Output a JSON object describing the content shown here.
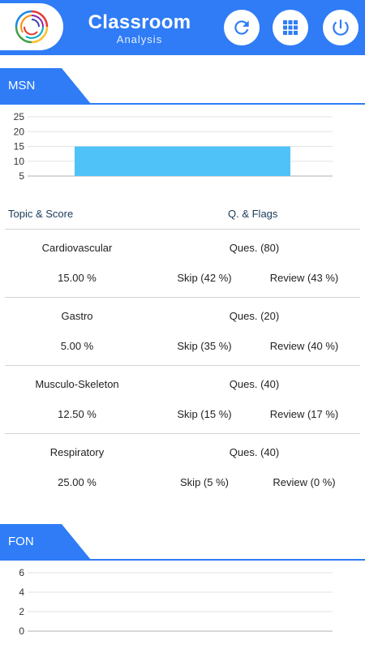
{
  "header": {
    "title": "Classroom",
    "subtitle": "Analysis",
    "logo_icon": "circular-rings-logo",
    "buttons": [
      {
        "name": "refresh-button",
        "icon": "refresh-icon"
      },
      {
        "name": "grid-menu-button",
        "icon": "grid-icon"
      },
      {
        "name": "power-button",
        "icon": "power-icon"
      }
    ],
    "accent_color": "#2f7cf6"
  },
  "sections": [
    {
      "label": "MSN",
      "columns": {
        "topic_score": "Topic & Score",
        "flags": "Q. & Flags"
      },
      "rows": [
        {
          "topic": "Cardiovascular",
          "score": "15.00 %",
          "questions": "Ques. (80)",
          "skip": "Skip (42 %)",
          "review": "Review (43 %)"
        },
        {
          "topic": "Gastro",
          "score": "5.00 %",
          "questions": "Ques. (20)",
          "skip": "Skip (35 %)",
          "review": "Review (40 %)"
        },
        {
          "topic": "Musculo-Skeleton",
          "score": "12.50 %",
          "questions": "Ques. (40)",
          "skip": "Skip (15 %)",
          "review": "Review (17 %)"
        },
        {
          "topic": "Respiratory",
          "score": "25.00 %",
          "questions": "Ques. (40)",
          "skip": "Skip (5 %)",
          "review": "Review (0 %)"
        }
      ]
    },
    {
      "label": "FON"
    }
  ],
  "chart_data": [
    {
      "type": "bar",
      "categories": [
        ""
      ],
      "values": [
        15
      ],
      "ylim": [
        5,
        25
      ],
      "yticks": [
        5,
        10,
        15,
        20,
        25
      ],
      "grid": true,
      "bar_color": "#4fc3f7"
    },
    {
      "type": "bar",
      "categories": [],
      "values": [],
      "ylim": [
        0,
        6
      ],
      "yticks": [
        0,
        2,
        4,
        6
      ],
      "grid": true
    }
  ]
}
